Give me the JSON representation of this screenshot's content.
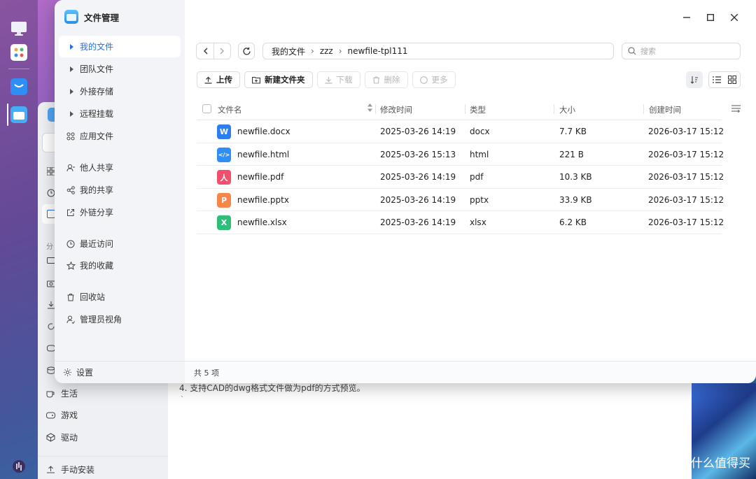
{
  "window": {
    "title": "文件管理",
    "controls": [
      "minimize-icon",
      "maximize-icon",
      "close-icon"
    ]
  },
  "sidebar": {
    "items": [
      {
        "label": "我的文件",
        "icon": "caret-right-icon",
        "active": true
      },
      {
        "label": "团队文件",
        "icon": "caret-right-icon"
      },
      {
        "label": "外接存储",
        "icon": "caret-right-icon"
      },
      {
        "label": "远程挂载",
        "icon": "caret-right-icon"
      },
      {
        "label": "应用文件",
        "icon": "apps-icon"
      },
      {
        "label": "他人共享",
        "icon": "user-share-icon"
      },
      {
        "label": "我的共享",
        "icon": "share-icon"
      },
      {
        "label": "外链分享",
        "icon": "external-link-icon"
      },
      {
        "label": "最近访问",
        "icon": "clock-icon"
      },
      {
        "label": "我的收藏",
        "icon": "star-icon"
      },
      {
        "label": "回收站",
        "icon": "trash-icon"
      },
      {
        "label": "管理员视角",
        "icon": "admin-icon"
      }
    ],
    "settings_label": "设置"
  },
  "toolbar": {
    "breadcrumb": [
      "我的文件",
      "zzz",
      "newfile-tpl111"
    ],
    "search_placeholder": "搜索",
    "upload_label": "上传",
    "new_folder_label": "新建文件夹",
    "download_label": "下载",
    "delete_label": "删除",
    "more_label": "更多"
  },
  "table": {
    "columns": [
      "文件名",
      "修改时间",
      "类型",
      "大小",
      "创建时间"
    ],
    "rows": [
      {
        "name": "newfile.docx",
        "modified": "2025-03-26 14:19",
        "type": "docx",
        "size": "7.7 KB",
        "created": "2026-03-17 15:12",
        "icon_color": "#2b7ff0",
        "icon_glyph": "W",
        "icon": "word-file-icon"
      },
      {
        "name": "newfile.html",
        "modified": "2025-03-26 15:13",
        "type": "html",
        "size": "221 B",
        "created": "2026-03-17 15:12",
        "icon_color": "#2f8ef5",
        "icon_glyph": "</>",
        "icon": "html-file-icon"
      },
      {
        "name": "newfile.pdf",
        "modified": "2025-03-26 14:19",
        "type": "pdf",
        "size": "10.3 KB",
        "created": "2026-03-17 15:12",
        "icon_color": "#f0506e",
        "icon_glyph": "人",
        "icon": "pdf-file-icon"
      },
      {
        "name": "newfile.pptx",
        "modified": "2025-03-26 14:19",
        "type": "pptx",
        "size": "33.9 KB",
        "created": "2026-03-17 15:12",
        "icon_color": "#f7864a",
        "icon_glyph": "P",
        "icon": "ppt-file-icon"
      },
      {
        "name": "newfile.xlsx",
        "modified": "2025-03-26 14:19",
        "type": "xlsx",
        "size": "6.2 KB",
        "created": "2026-03-17 15:12",
        "icon_color": "#2dbf7a",
        "icon_glyph": "X",
        "icon": "excel-file-icon"
      }
    ]
  },
  "footer": {
    "count_text": "共 5 项"
  },
  "background_app": {
    "sidebar_items": [
      "生活",
      "游戏",
      "驱动",
      "手动安装"
    ],
    "partial_label": "分",
    "note_text": "4. 支持CAD的dwg格式文件做为pdf的方式预览。",
    "tick": "`"
  },
  "watermark": {
    "text": "什么值得买",
    "logo_glyph": "值"
  },
  "colors": {
    "accent": "#1f6fe5",
    "sidebar_bg": "#f3f4f7"
  }
}
